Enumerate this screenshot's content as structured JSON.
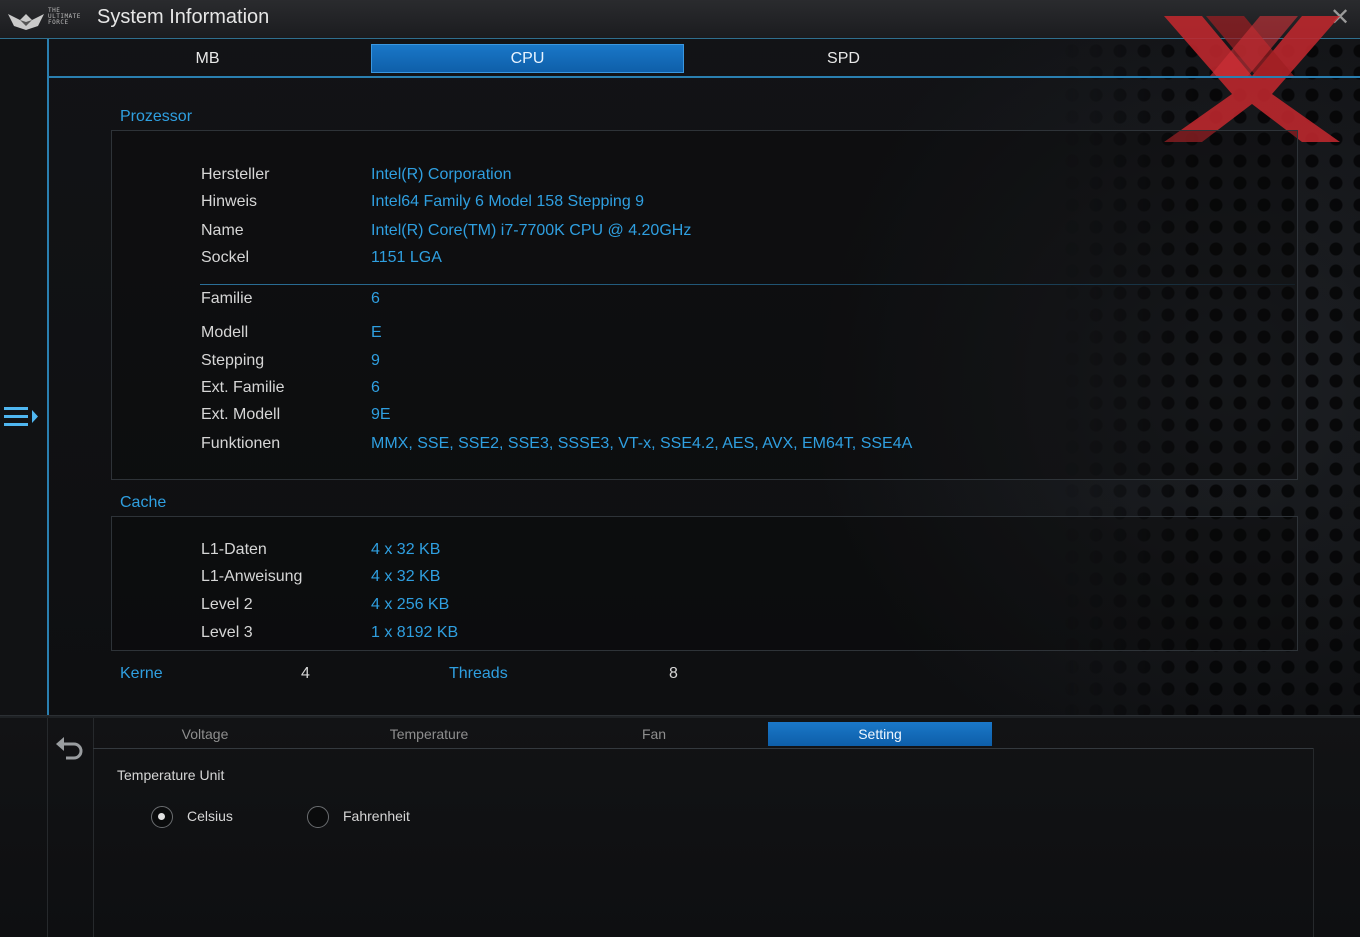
{
  "window": {
    "title": "System Information",
    "logo_text": "THE ULTIMATE FORCE",
    "close_glyph": "✕"
  },
  "tabs": [
    {
      "label": "MB",
      "active": false
    },
    {
      "label": "CPU",
      "active": true
    },
    {
      "label": "SPD",
      "active": false
    }
  ],
  "processor": {
    "title": "Prozessor",
    "rows": [
      {
        "label": "Hersteller",
        "value": "Intel(R) Corporation"
      },
      {
        "label": "Hinweis",
        "value": "Intel64 Family 6 Model 158 Stepping 9"
      },
      {
        "label": "Name",
        "value": "Intel(R) Core(TM) i7-7700K CPU @ 4.20GHz"
      },
      {
        "label": "Sockel",
        "value": "1151 LGA"
      },
      {
        "label": "Familie",
        "value": "6"
      },
      {
        "label": "Modell",
        "value": "E"
      },
      {
        "label": "Stepping",
        "value": "9"
      },
      {
        "label": "Ext. Familie",
        "value": "6"
      },
      {
        "label": "Ext. Modell",
        "value": "9E"
      },
      {
        "label": "Funktionen",
        "value": "MMX, SSE, SSE2, SSE3, SSSE3, VT-x, SSE4.2, AES, AVX, EM64T, SSE4A"
      }
    ]
  },
  "cache": {
    "title": "Cache",
    "rows": [
      {
        "label": "L1-Daten",
        "value": "4 x 32 KB"
      },
      {
        "label": "L1-Anweisung",
        "value": "4 x 32 KB"
      },
      {
        "label": "Level 2",
        "value": "4 x 256 KB"
      },
      {
        "label": "Level 3",
        "value": "1 x 8192 KB"
      }
    ]
  },
  "counts": {
    "cores_label": "Kerne",
    "cores_value": "4",
    "threads_label": "Threads",
    "threads_value": "8"
  },
  "bottom_tabs": [
    {
      "label": "Voltage",
      "active": false
    },
    {
      "label": "Temperature",
      "active": false
    },
    {
      "label": "Fan",
      "active": false
    },
    {
      "label": "Setting",
      "active": true
    }
  ],
  "settings": {
    "temperature_unit_label": "Temperature Unit",
    "options": [
      {
        "label": "Celsius",
        "selected": true
      },
      {
        "label": "Fahrenheit",
        "selected": false
      }
    ]
  },
  "icons": {
    "menu": "menu-toggle-icon",
    "back": "back-arrow-icon",
    "close": "close-icon",
    "brand": "brand-x-icon"
  },
  "colors": {
    "accent": "#2f9fe0",
    "tab_active": "#0e5ea8",
    "brand_red": "#c0282d"
  }
}
